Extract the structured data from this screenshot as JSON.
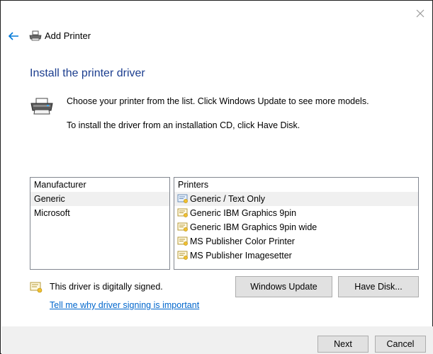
{
  "window": {
    "title": "Add Printer",
    "close_glyph": "✕",
    "back_glyph": "←"
  },
  "page": {
    "heading": "Install the printer driver",
    "description_line1": "Choose your printer from the list. Click Windows Update to see more models.",
    "description_line2": "To install the driver from an installation CD, click Have Disk."
  },
  "manufacturer_list": {
    "header": "Manufacturer",
    "items": [
      "Generic",
      "Microsoft"
    ],
    "selected": "Generic"
  },
  "printers_list": {
    "header": "Printers",
    "items": [
      "Generic / Text Only",
      "Generic IBM Graphics 9pin",
      "Generic IBM Graphics 9pin wide",
      "MS Publisher Color Printer",
      "MS Publisher Imagesetter"
    ],
    "selected": "Generic / Text Only"
  },
  "signature": {
    "status_text": "This driver is digitally signed.",
    "link_text": "Tell me why driver signing is important"
  },
  "buttons": {
    "windows_update": "Windows Update",
    "have_disk": "Have Disk...",
    "next": "Next",
    "cancel": "Cancel"
  },
  "icons": {
    "title_icon": "printer-icon",
    "big_icon": "printer-icon",
    "cert_icon": "certificate-icon",
    "signed_icon": "certificate-icon"
  },
  "colors": {
    "heading": "#1c3e8f",
    "link": "#0066cc",
    "back_arrow": "#0078d7",
    "footer_bg": "#f0f0f0",
    "button_bg": "#e1e1e1"
  }
}
